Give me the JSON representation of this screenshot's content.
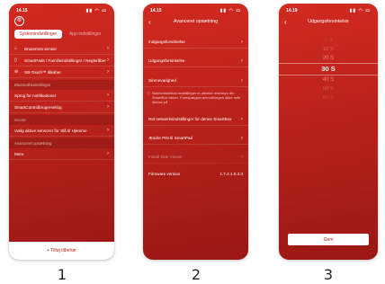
{
  "phone1": {
    "time": "14.15",
    "tabs": [
      "Systemindstillinger",
      "App-indstillinger"
    ],
    "items": [
      {
        "label": "Brusernes sensor",
        "icon": "shower-icon"
      },
      {
        "label": "SmartPads / Familieindstillinger / Negleråber",
        "icon": "phone-icon"
      },
      {
        "label": "SB-Touch™ tilkøber",
        "icon": "badge-icon"
      }
    ],
    "section_1": "Bluetoothindstillinger",
    "items_2": [
      "Sprog for notifikationer",
      "SmartControlbrugersetlog"
    ],
    "section_2": "Scorer",
    "items_3": [
      "Vælg aktive sensorer for Slå til Hjemme"
    ],
    "section_3": "Avanceret opsætning",
    "items_4": [
      "Mere"
    ],
    "add_button": "+ Tilføj tilbehør"
  },
  "phone2": {
    "time": "14.15",
    "title": "Avanceret opsætning",
    "items_a": [
      "Indgangsforsinkelse",
      "Udgangsforsinkelse",
      "Sirenevarighed"
    ],
    "note": "Notesmiddelbar indstillinger et påvirke resesbyn din SmartBox sikker. Forespørgsel anmodningen sikre hele dinbox på",
    "items_b": [
      "Ret netværksindstillinger for denne SmartBox",
      "Ændre PIN til SmartPad",
      "Install Side Viewer"
    ],
    "firmware_label": "Firmware version",
    "firmware_value": "1.7.4.1.0.3.3"
  },
  "phone3": {
    "time": "14.19",
    "title": "Udgangsforsinkelse",
    "options": [
      "0 S",
      "10 S",
      "20 S",
      "30 S",
      "40 S",
      "50 S",
      "60 S"
    ],
    "selected": "30 S",
    "save": "Gem"
  },
  "captions": [
    "1",
    "2",
    "3"
  ]
}
